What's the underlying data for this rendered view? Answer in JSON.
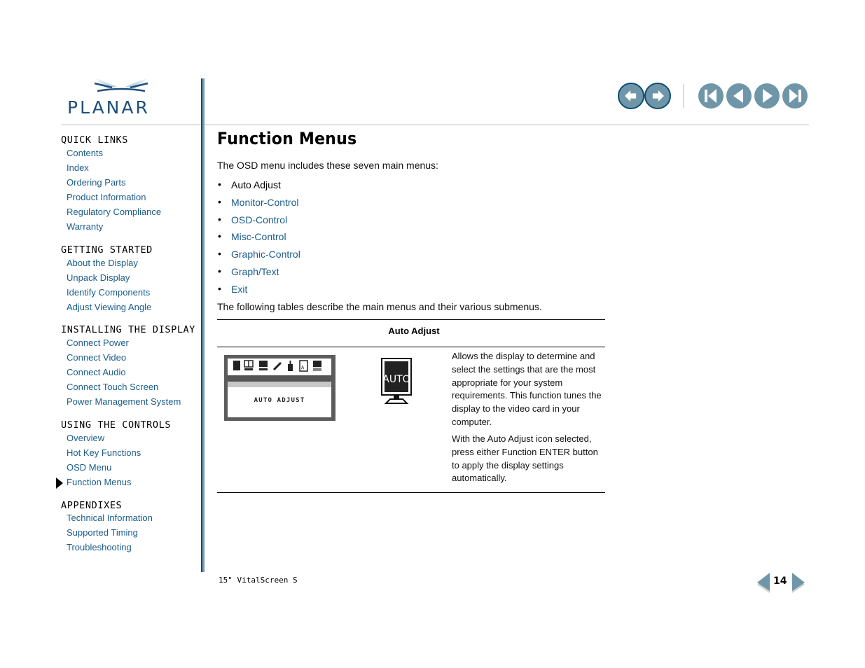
{
  "brand": {
    "logo_text": "PLANAR"
  },
  "top_nav": {
    "buttons": [
      {
        "name": "back-button",
        "icon": "arrow-left-icon"
      },
      {
        "name": "forward-button",
        "icon": "arrow-right-icon"
      },
      {
        "name": "first-page-button",
        "icon": "skip-first-icon"
      },
      {
        "name": "previous-page-button",
        "icon": "triangle-left-icon"
      },
      {
        "name": "next-page-button",
        "icon": "triangle-right-icon"
      },
      {
        "name": "last-page-button",
        "icon": "skip-last-icon"
      }
    ]
  },
  "sidebar": {
    "sections": [
      {
        "heading": "QUICK LINKS",
        "items": [
          "Contents",
          "Index",
          "Ordering Parts",
          "Product Information",
          "Regulatory Compliance",
          "Warranty"
        ]
      },
      {
        "heading": "GETTING STARTED",
        "items": [
          "About the Display",
          "Unpack Display",
          "Identify Components",
          "Adjust Viewing Angle"
        ]
      },
      {
        "heading": "INSTALLING THE DISPLAY",
        "items": [
          "Connect Power",
          "Connect Video",
          "Connect Audio",
          "Connect Touch Screen",
          "Power Management System"
        ]
      },
      {
        "heading": "USING THE CONTROLS",
        "items": [
          "Overview",
          "Hot Key Functions",
          "OSD Menu",
          "Function Menus"
        ]
      },
      {
        "heading": "APPENDIXES",
        "items": [
          "Technical Information",
          "Supported Timing",
          "Troubleshooting"
        ]
      }
    ],
    "current_item": "Function Menus"
  },
  "main": {
    "title": "Function Menus",
    "intro": "The OSD menu includes these seven main menus:",
    "menus": [
      {
        "label": "Auto Adjust",
        "link": false
      },
      {
        "label": "Monitor-Control",
        "link": true
      },
      {
        "label": "OSD-Control",
        "link": true
      },
      {
        "label": "Misc-Control",
        "link": true
      },
      {
        "label": "Graphic-Control",
        "link": true
      },
      {
        "label": "Graph/Text",
        "link": true
      },
      {
        "label": "Exit",
        "link": true
      }
    ],
    "bullet": "•",
    "tables_intro": "The following tables describe the main menus and their various submenus.",
    "table": {
      "heading": "Auto Adjust",
      "osd_label": "AUTO ADJUST",
      "icon_label": "AUTO",
      "description": [
        "Allows the display to determine and select the settings that are the most appropriate for your system requirements. This function tunes the display to the video card in your computer.",
        "With the Auto Adjust icon selected, press either Function ENTER button to apply the display settings automatically."
      ]
    }
  },
  "footer": {
    "product": "15\" VitalScreen S",
    "page_number": "14"
  },
  "colors": {
    "link": "#1a5c8a",
    "nav_button": "#6f96a8",
    "nav_outline": "#0f4d73"
  }
}
